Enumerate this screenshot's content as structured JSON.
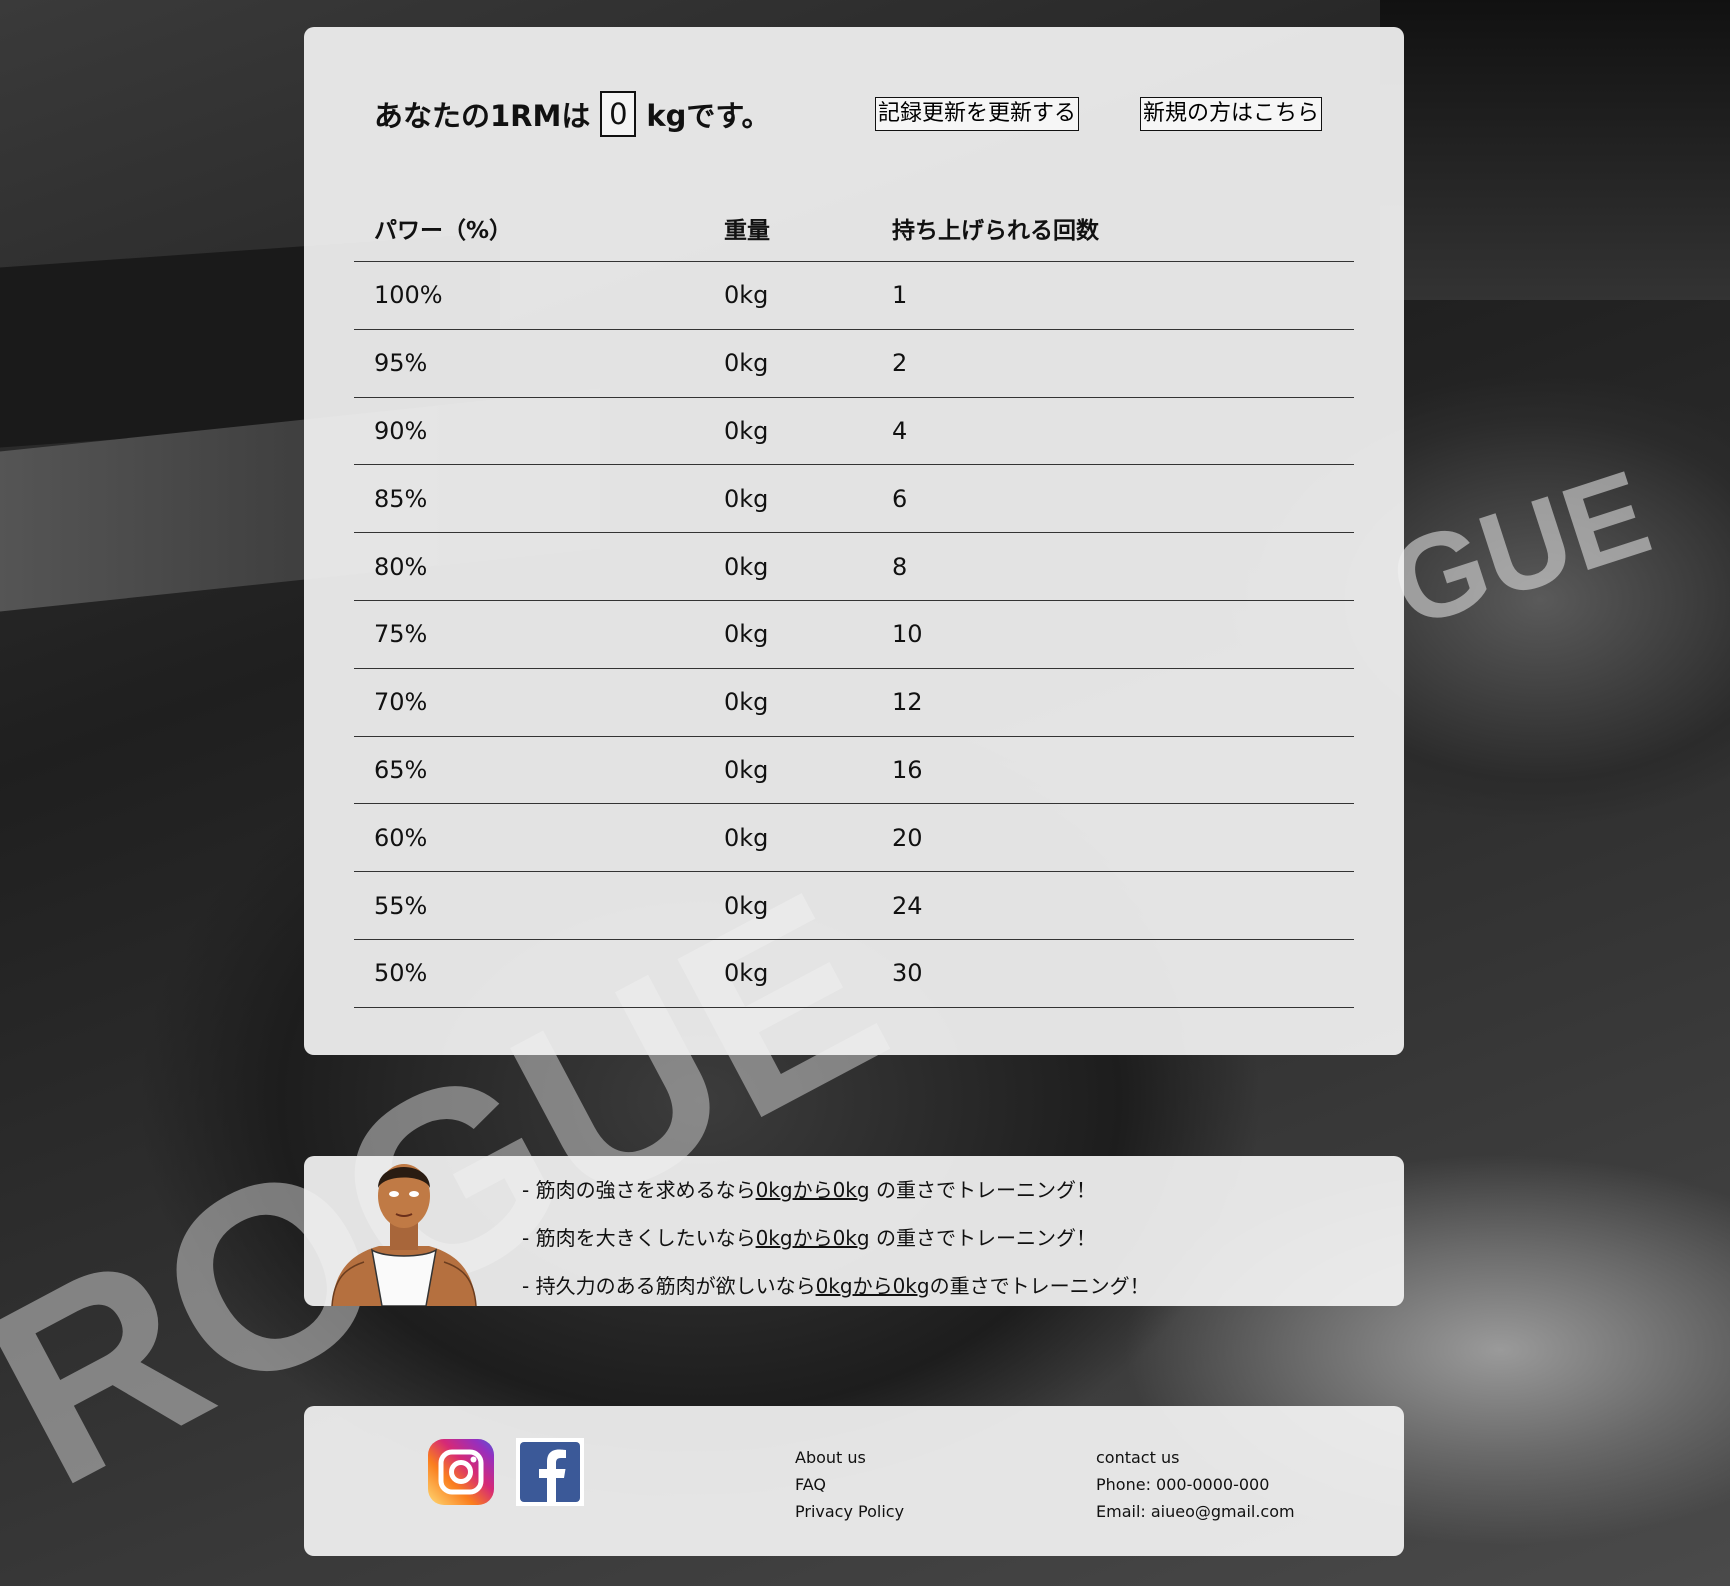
{
  "header": {
    "rm_prefix": "あなたの1RMは",
    "rm_value": "0",
    "rm_suffix": "kgです。",
    "update_button": "記録更新を更新する",
    "new_button": "新規の方はこちら"
  },
  "table": {
    "headers": [
      "パワー（%）",
      "重量",
      "持ち上げられる回数"
    ],
    "rows": [
      [
        "100%",
        "0kg",
        "1"
      ],
      [
        "95%",
        "0kg",
        "2"
      ],
      [
        "90%",
        "0kg",
        "4"
      ],
      [
        "85%",
        "0kg",
        "6"
      ],
      [
        "80%",
        "0kg",
        "8"
      ],
      [
        "75%",
        "0kg",
        "10"
      ],
      [
        "70%",
        "0kg",
        "12"
      ],
      [
        "65%",
        "0kg",
        "16"
      ],
      [
        "60%",
        "0kg",
        "20"
      ],
      [
        "55%",
        "0kg",
        "24"
      ],
      [
        "50%",
        "0kg",
        "30"
      ]
    ]
  },
  "tips": [
    {
      "prefix": "- 筋肉の強さを求めるなら",
      "range": "0kgから0kg",
      "suffix": " の重さでトレーニング！"
    },
    {
      "prefix": "- 筋肉を大きくしたいなら",
      "range": "0kgから0kg",
      "suffix": " の重さでトレーニング！"
    },
    {
      "prefix": "- 持久力のある筋肉が欲しいなら",
      "range": "0kgから0kg",
      "suffix": "の重さでトレーニング！"
    }
  ],
  "footer": {
    "social_icons": [
      "instagram-icon",
      "facebook-icon"
    ],
    "links": [
      "About us",
      "FAQ",
      "Privacy Policy"
    ],
    "contact": {
      "title": "contact us",
      "phone": "Phone: 000-0000-000",
      "email": "Email: aiueo@gmail.com"
    }
  },
  "colors": {
    "panel": "#f2f2f2",
    "text": "#111111",
    "instagram_gradient": [
      "#feda75",
      "#d62976",
      "#962fbf",
      "#4f5bd5"
    ],
    "facebook": "#3b5998"
  }
}
